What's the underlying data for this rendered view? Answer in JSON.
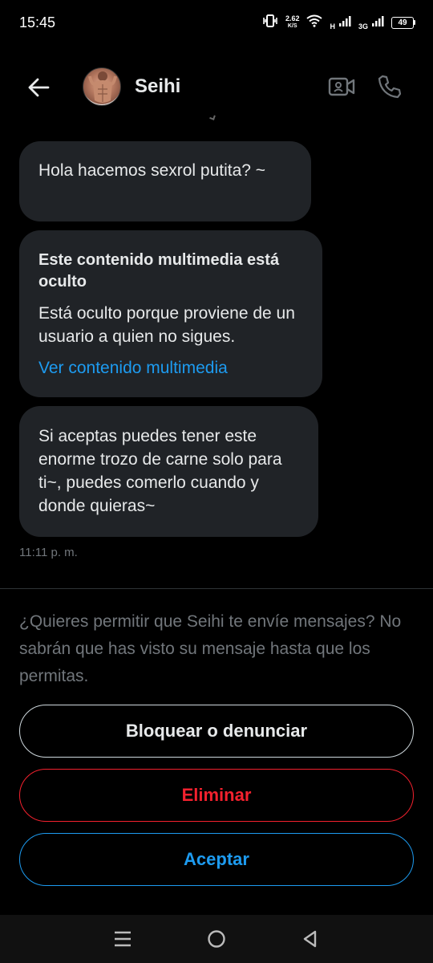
{
  "status_bar": {
    "time": "15:45",
    "speed_value": "2.62",
    "speed_unit": "K/S",
    "net_h": "H",
    "net_3g": "3G",
    "battery": "49"
  },
  "header": {
    "name": "Seihi",
    "back_icon": "arrow-left-icon",
    "video_icon": "video-camera-icon",
    "call_icon": "phone-icon"
  },
  "messages": [
    {
      "text": "Hola hacemos sexrol putita? ~"
    },
    {
      "hidden_title": "Este contenido multimedia está oculto",
      "hidden_desc": "Está oculto porque proviene de un usuario a quien no sigues.",
      "link": "Ver contenido multimedia"
    },
    {
      "text": "Si aceptas puedes tener este enorme trozo de carne solo para ti~, puedes comerlo cuando y donde quieras~"
    }
  ],
  "timestamp": "11:11 p. m.",
  "request": {
    "text": "¿Quieres permitir que Seihi te envíe mensajes? No sabrán que has visto su mensaje hasta que los permitas.",
    "block_label": "Bloquear o denunciar",
    "delete_label": "Eliminar",
    "accept_label": "Aceptar"
  },
  "colors": {
    "accent": "#1d9bf0",
    "danger": "#f4212e",
    "bubble": "#202327",
    "muted": "#71767b"
  }
}
